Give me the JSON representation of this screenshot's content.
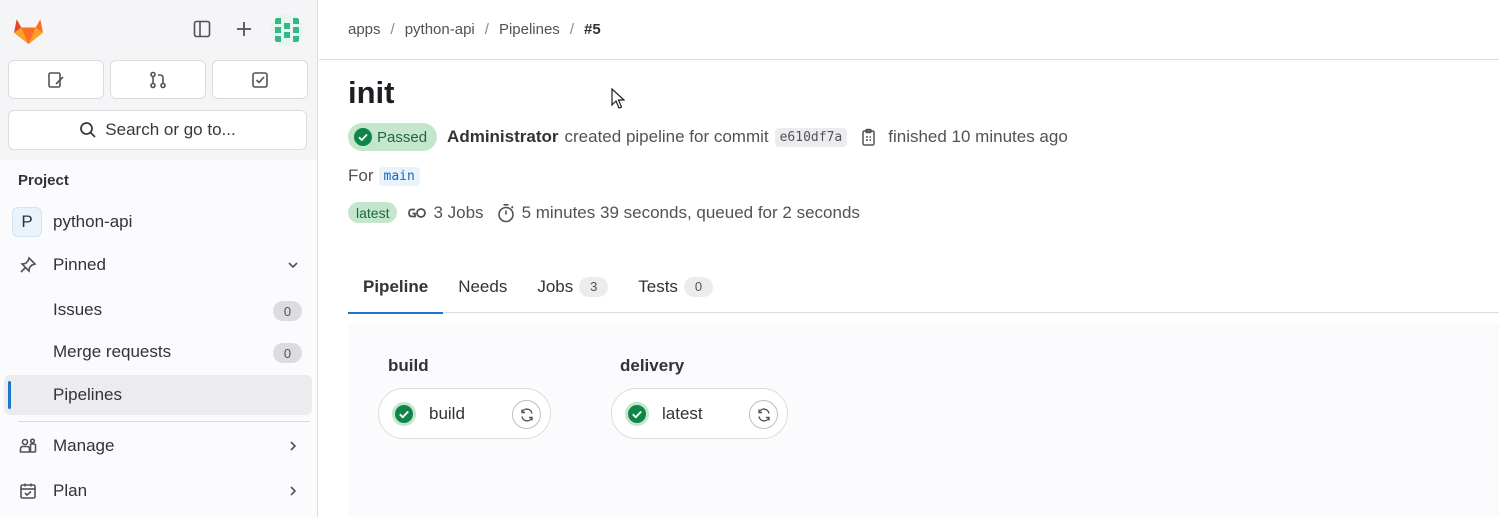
{
  "sidebar": {
    "search_label": "Search or go to...",
    "section_title": "Project",
    "project": {
      "avatar_letter": "P",
      "name": "python-api"
    },
    "pinned_label": "Pinned",
    "pinned_items": [
      {
        "label": "Issues",
        "count": "0"
      },
      {
        "label": "Merge requests",
        "count": "0"
      },
      {
        "label": "Pipelines"
      }
    ],
    "manage_label": "Manage",
    "plan_label": "Plan"
  },
  "breadcrumb": [
    "apps",
    "python-api",
    "Pipelines",
    "#5"
  ],
  "pipeline": {
    "title": "init",
    "status": "Passed",
    "author": "Administrator",
    "action_text": "created pipeline for commit",
    "commit_sha": "e610df7a",
    "finished_text": "finished 10 minutes ago",
    "for_label": "For",
    "ref": "main",
    "latest_badge": "latest",
    "jobs_text": "3 Jobs",
    "duration_text": "5 minutes 39 seconds, queued for 2 seconds"
  },
  "tabs": [
    {
      "label": "Pipeline"
    },
    {
      "label": "Needs"
    },
    {
      "label": "Jobs",
      "count": "3"
    },
    {
      "label": "Tests",
      "count": "0"
    }
  ],
  "stages": [
    {
      "title": "build",
      "jobs": [
        {
          "name": "build",
          "status": "success"
        }
      ]
    },
    {
      "title": "delivery",
      "jobs": [
        {
          "name": "latest",
          "status": "success"
        }
      ]
    }
  ],
  "colors": {
    "accent": "#1f75cb",
    "success": "#108548",
    "success_bg": "#c3e6cd"
  }
}
